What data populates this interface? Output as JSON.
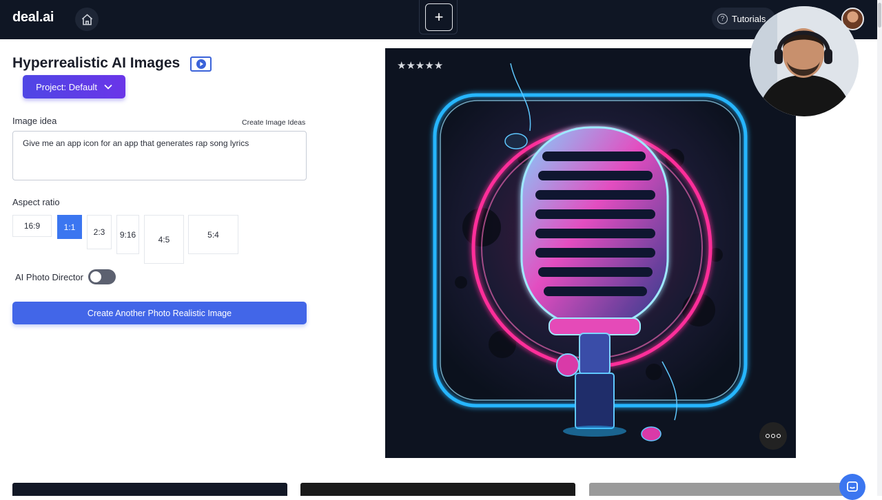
{
  "topbar": {
    "logo": "deal.ai",
    "tutorials_label": "Tutorials"
  },
  "page": {
    "title": "Hyperrealistic AI Images",
    "project_button": "Project: Default"
  },
  "image_idea": {
    "label": "Image idea",
    "ideas_link": "Create Image Ideas",
    "value": "Give me an app icon for an app that generates rap song lyrics"
  },
  "aspect_ratio": {
    "label": "Aspect ratio",
    "options": [
      "16:9",
      "1:1",
      "2:3",
      "9:16",
      "4:5",
      "5:4"
    ],
    "selected": "1:1"
  },
  "photo_director": {
    "label": "AI Photo Director",
    "enabled": false
  },
  "create_button": "Create Another Photo Realistic Image",
  "result": {
    "rating_stars": "★★★★★",
    "subject": "neon microphone app icon"
  },
  "colors": {
    "topbar": "#0f1624",
    "accent": "#4266e8",
    "project_gradient_start": "#4f46e5",
    "neon_pink": "#ff2f9a",
    "neon_blue": "#27b6ff"
  },
  "icons": [
    "home-icon",
    "plus-icon",
    "help-icon",
    "video-icon",
    "chevron-down-icon",
    "more-icon",
    "chat-icon"
  ]
}
